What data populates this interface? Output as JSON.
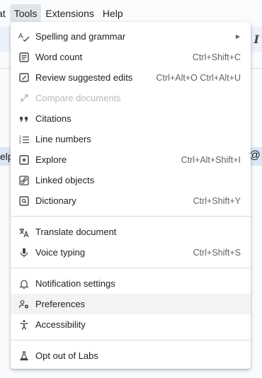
{
  "menubar": {
    "items": [
      "at",
      "Tools",
      "Extensions",
      "Help"
    ]
  },
  "doc": {
    "left_text": "elp"
  },
  "menu": {
    "spelling": {
      "label": "Spelling and grammar"
    },
    "word_count": {
      "label": "Word count",
      "shortcut": "Ctrl+Shift+C"
    },
    "review": {
      "label": "Review suggested edits",
      "shortcut": "Ctrl+Alt+O Ctrl+Alt+U"
    },
    "compare": {
      "label": "Compare documents"
    },
    "citations": {
      "label": "Citations"
    },
    "line_numbers": {
      "label": "Line numbers"
    },
    "explore": {
      "label": "Explore",
      "shortcut": "Ctrl+Alt+Shift+I"
    },
    "linked_objects": {
      "label": "Linked objects"
    },
    "dictionary": {
      "label": "Dictionary",
      "shortcut": "Ctrl+Shift+Y"
    },
    "translate": {
      "label": "Translate document"
    },
    "voice_typing": {
      "label": "Voice typing",
      "shortcut": "Ctrl+Shift+S"
    },
    "notification": {
      "label": "Notification settings"
    },
    "preferences": {
      "label": "Preferences"
    },
    "accessibility": {
      "label": "Accessibility"
    },
    "labs": {
      "label": "Opt out of Labs"
    }
  },
  "colors": {
    "menubar_active": "#e1e5ea",
    "hover_row": "#f1f3f4",
    "disabled_text": "#b6b9bd",
    "shortcut_text": "#5f6368"
  }
}
